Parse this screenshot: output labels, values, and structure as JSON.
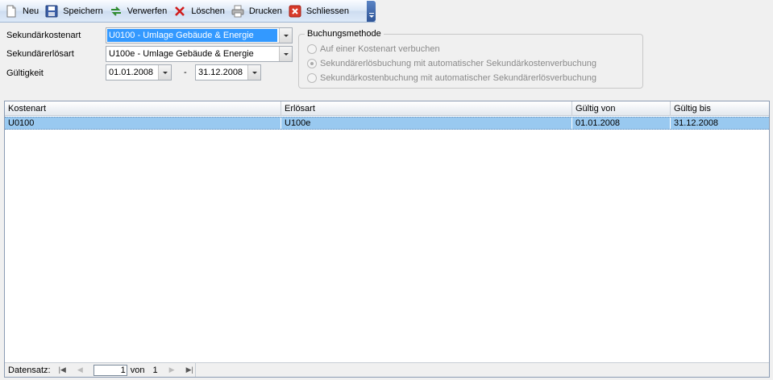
{
  "toolbar": {
    "items": [
      {
        "label": "Neu",
        "icon": "new-document-icon"
      },
      {
        "label": "Speichern",
        "icon": "floppy-disk-icon"
      },
      {
        "label": "Verwerfen",
        "icon": "discard-arrows-icon"
      },
      {
        "label": "Löschen",
        "icon": "red-x-icon"
      },
      {
        "label": "Drucken",
        "icon": "printer-icon"
      },
      {
        "label": "Schliessen",
        "icon": "close-box-icon"
      }
    ]
  },
  "form": {
    "sekundaerkostenart_label": "Sekundärkostenart",
    "sekundaerkostenart_value": "U0100 - Umlage Gebäude & Energie",
    "sekundaererloesart_label": "Sekundärerlösart",
    "sekundaererloesart_value": "U100e - Umlage Gebäude & Energie",
    "gueltigkeit_label": "Gültigkeit",
    "gueltig_von": "01.01.2008",
    "separator": "-",
    "gueltig_bis": "31.12.2008"
  },
  "buchungsmethode": {
    "title": "Buchungsmethode",
    "options": [
      {
        "label": "Auf einer Kostenart verbuchen",
        "checked": false
      },
      {
        "label": "Sekundärerlösbuchung mit automatischer Sekundärkostenverbuchung",
        "checked": true
      },
      {
        "label": "Sekundärkostenbuchung mit automatischer Sekundärerlösverbuchung",
        "checked": false
      }
    ]
  },
  "grid": {
    "columns": [
      "Kostenart",
      "Erlösart",
      "Gültig von",
      "Gültig bis"
    ],
    "rows": [
      [
        "U0100",
        "U100e",
        "01.01.2008",
        "31.12.2008"
      ]
    ]
  },
  "navigator": {
    "label": "Datensatz:",
    "current": "1",
    "of_label": "von",
    "total": "1"
  },
  "colors": {
    "selection": "#3399ff",
    "row_highlight": "#99c9f0",
    "toolbar_grip": "#2f5597"
  }
}
